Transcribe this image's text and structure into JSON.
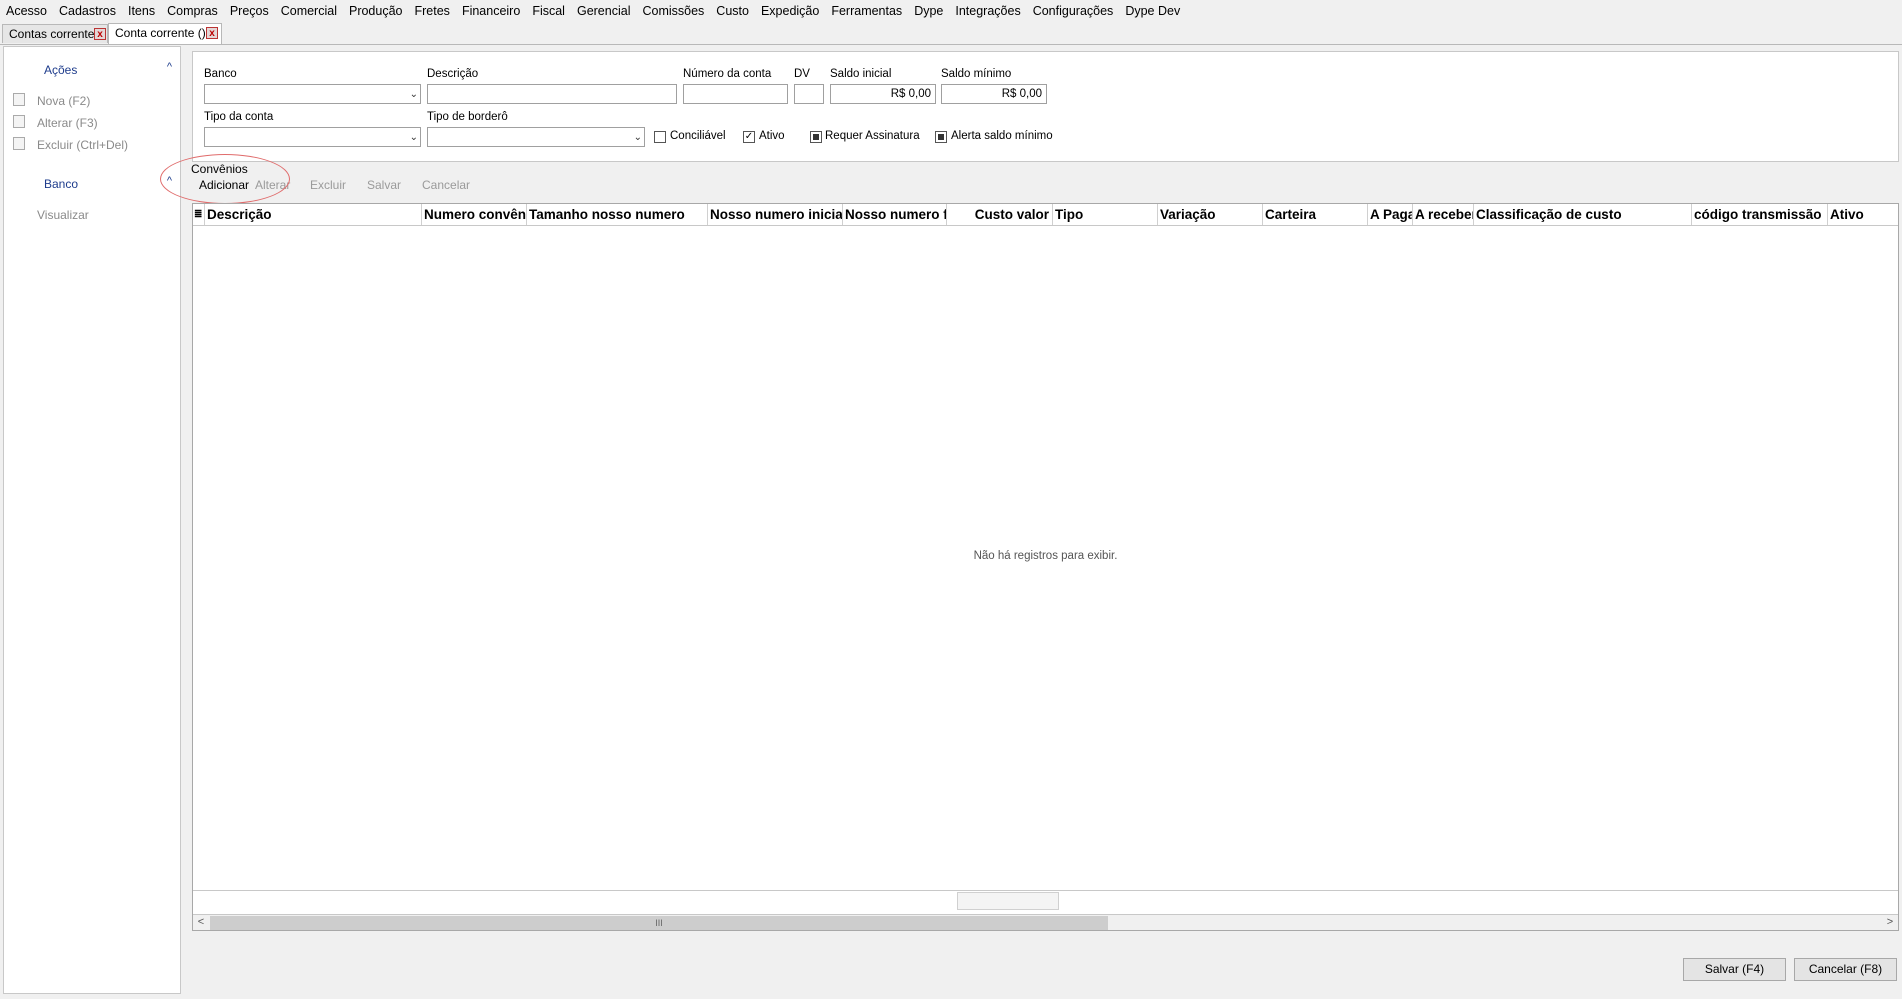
{
  "menu": [
    "Acesso",
    "Cadastros",
    "Itens",
    "Compras",
    "Preços",
    "Comercial",
    "Produção",
    "Fretes",
    "Financeiro",
    "Fiscal",
    "Gerencial",
    "Comissões",
    "Custo",
    "Expedição",
    "Ferramentas",
    "Dype",
    "Integrações",
    "Configurações",
    "Dype Dev"
  ],
  "tabs": [
    {
      "label": "Contas corrente",
      "close": "x"
    },
    {
      "label": "Conta corrente ()",
      "close": "x"
    }
  ],
  "sidebar": {
    "acoes_title": "Ações",
    "acoes_items": [
      "Nova (F2)",
      "Alterar (F3)",
      "Excluir (Ctrl+Del)"
    ],
    "banco_title": "Banco",
    "banco_items": [
      "Visualizar"
    ],
    "chevron": "^"
  },
  "form": {
    "banco_label": "Banco",
    "descricao_label": "Descrição",
    "numero_conta_label": "Número da conta",
    "dv_label": "DV",
    "saldo_inicial_label": "Saldo inicial",
    "saldo_inicial_value": "R$ 0,00",
    "saldo_minimo_label": "Saldo mínimo",
    "saldo_minimo_value": "R$ 0,00",
    "tipo_conta_label": "Tipo da conta",
    "tipo_bordero_label": "Tipo de borderô",
    "conciliavel_label": "Conciliável",
    "ativo_label": "Ativo",
    "ativo_check": "✓",
    "requer_assinatura_label": "Requer Assinatura",
    "alerta_saldo_label": "Alerta saldo mínimo",
    "combo_arrow": "⌄"
  },
  "convenios": {
    "title": "Convênios",
    "buttons": [
      "Adicionar",
      "Alterar",
      "Excluir",
      "Salvar",
      "Cancelar"
    ]
  },
  "grid": {
    "row_icon": "≣",
    "columns": [
      "Descrição",
      "Numero convênio",
      "Tamanho nosso numero",
      "Nosso numero inicial",
      "Nosso numero final",
      "Custo valor",
      "Tipo",
      "Variação",
      "Carteira",
      "A Pagar",
      "A receber",
      "Classificação de custo",
      "código transmissão",
      "Ativo"
    ],
    "empty_message": "Não há registros para exibir.",
    "scroll_left": "<",
    "scroll_right": ">",
    "scroll_grip": "III"
  },
  "footer": {
    "save_label": "Salvar (F4)",
    "cancel_label": "Cancelar (F8)"
  }
}
